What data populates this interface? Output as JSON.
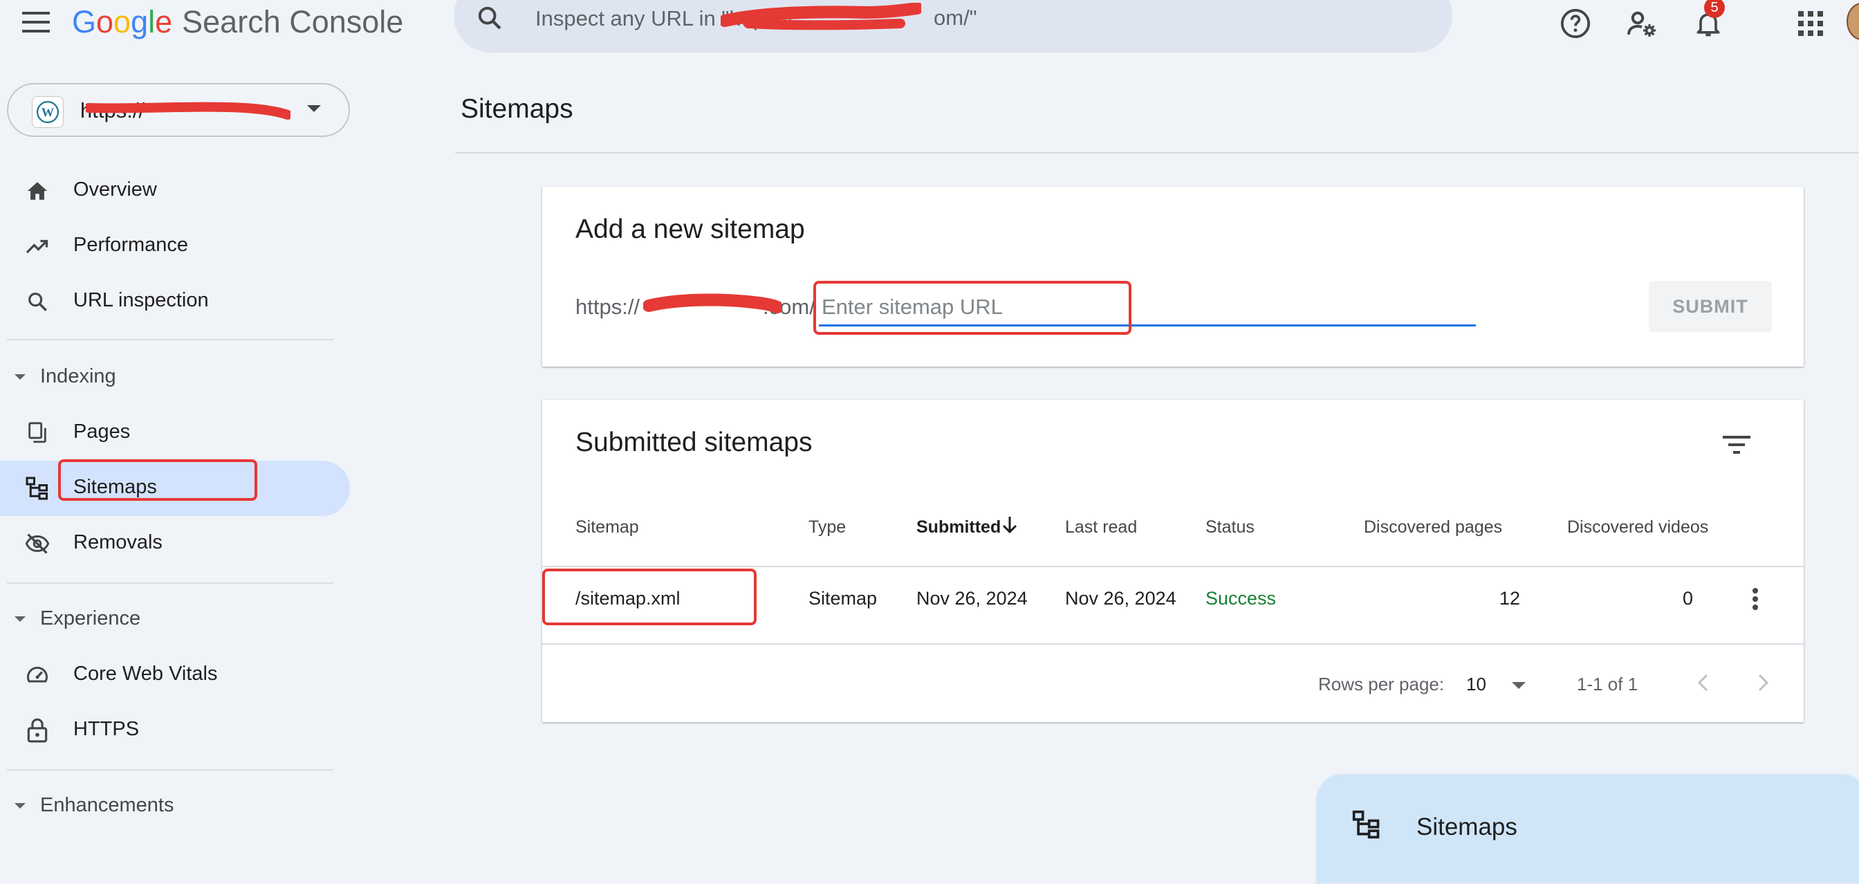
{
  "app": {
    "title_google": "Google",
    "title_product": "Search Console",
    "search_placeholder": "Inspect any URL in \"https://",
    "search_suffix": "om/\"",
    "notification_count": "5"
  },
  "property": {
    "text": "https://"
  },
  "sidebar": {
    "nav_top": [
      {
        "label": "Overview",
        "icon": "home-icon"
      },
      {
        "label": "Performance",
        "icon": "trending-up-icon"
      },
      {
        "label": "URL inspection",
        "icon": "search-icon"
      }
    ],
    "sections": [
      {
        "label": "Indexing"
      },
      {
        "label": "Experience"
      },
      {
        "label": "Enhancements"
      }
    ],
    "indexing_items": [
      {
        "label": "Pages",
        "icon": "pages-icon"
      },
      {
        "label": "Sitemaps",
        "icon": "sitemap-icon",
        "active": true
      },
      {
        "label": "Removals",
        "icon": "visibility-off-icon"
      }
    ],
    "experience_items": [
      {
        "label": "Core Web Vitals",
        "icon": "speed-icon"
      },
      {
        "label": "HTTPS",
        "icon": "lock-icon"
      }
    ]
  },
  "main": {
    "page_title": "Sitemaps",
    "add_card": {
      "title": "Add a new sitemap",
      "prefix": "https://",
      "prefix_end": ".com/",
      "input_placeholder": "Enter sitemap URL",
      "submit_label": "SUBMIT"
    },
    "list_card": {
      "title": "Submitted sitemaps",
      "columns": [
        "Sitemap",
        "Type",
        "Submitted",
        "Last read",
        "Status",
        "Discovered pages",
        "Discovered videos"
      ],
      "rows": [
        {
          "sitemap": "/sitemap.xml",
          "type": "Sitemap",
          "submitted": "Nov 26, 2024",
          "last_read": "Nov 26, 2024",
          "status": "Success",
          "discovered_pages": "12",
          "discovered_videos": "0"
        }
      ],
      "footer": {
        "rows_per_page_label": "Rows per page:",
        "rows_per_page_value": "10",
        "range": "1-1 of 1"
      }
    }
  },
  "bottom_panel": {
    "label": "Sitemaps"
  },
  "colors": {
    "accent": "#1a73e8",
    "active_nav": "#d3e3fd",
    "success": "#188038",
    "annotation": "#e53935"
  }
}
